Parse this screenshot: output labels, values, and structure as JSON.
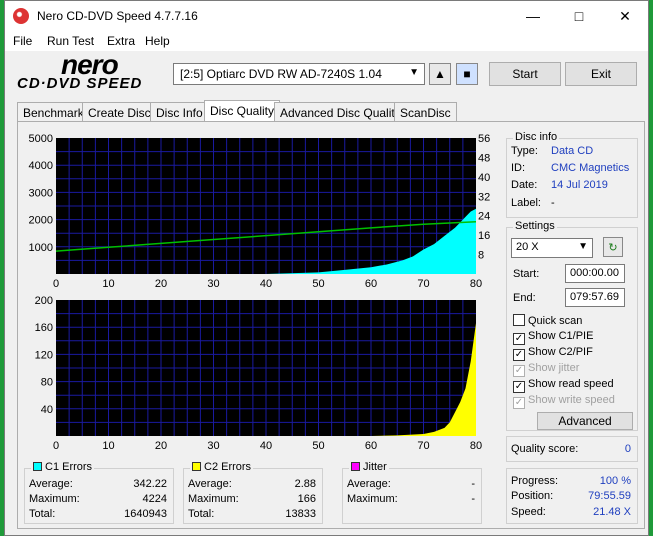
{
  "window": {
    "title": "Nero CD-DVD Speed 4.7.7.16"
  },
  "menu": [
    "File",
    "Run Test",
    "Extra",
    "Help"
  ],
  "logo": {
    "top": "nero",
    "bottom": "CD·DVD SPEED"
  },
  "toolbar": {
    "drive": "[2:5]   Optiarc DVD RW AD-7240S 1.04",
    "start_label": "Start",
    "exit_label": "Exit"
  },
  "tabs": [
    "Benchmark",
    "Create Disc",
    "Disc Info",
    "Disc Quality",
    "Advanced Disc Quality",
    "ScanDisc"
  ],
  "active_tab": "Disc Quality",
  "disc_info": {
    "title": "Disc info",
    "type_label": "Type:",
    "type": "Data CD",
    "id_label": "ID:",
    "id": "CMC Magnetics",
    "date_label": "Date:",
    "date": "14 Jul 2019",
    "label_label": "Label:",
    "label": "-"
  },
  "settings": {
    "title": "Settings",
    "speed": "20 X",
    "start_label": "Start:",
    "start": "000:00.00",
    "end_label": "End:",
    "end": "079:57.69",
    "quick_scan": "Quick scan",
    "show_c1": "Show C1/PIE",
    "show_c2": "Show C2/PIF",
    "show_jitter": "Show jitter",
    "show_read": "Show read speed",
    "show_write": "Show write speed",
    "advanced_label": "Advanced"
  },
  "quality": {
    "label": "Quality score:",
    "value": "0"
  },
  "progress": {
    "progress_label": "Progress:",
    "progress": "100 %",
    "position_label": "Position:",
    "position": "79:55.59",
    "speed_label": "Speed:",
    "speed": "21.48 X"
  },
  "c1": {
    "title": "C1 Errors",
    "avg_label": "Average:",
    "avg": "342.22",
    "max_label": "Maximum:",
    "max": "4224",
    "total_label": "Total:",
    "total": "1640943"
  },
  "c2": {
    "title": "C2 Errors",
    "avg_label": "Average:",
    "avg": "2.88",
    "max_label": "Maximum:",
    "max": "166",
    "total_label": "Total:",
    "total": "13833"
  },
  "jitter": {
    "title": "Jitter",
    "avg_label": "Average:",
    "avg": "-",
    "max_label": "Maximum:",
    "max": "-"
  },
  "colors": {
    "c1": "#00ffff",
    "c2": "#ffff00",
    "jitter": "#ff00ff",
    "speed": "#00c000",
    "grid": "#1a1aa0",
    "plot_bg": "#000000"
  },
  "chart_data": [
    {
      "type": "area",
      "x_ticks": [
        0,
        10,
        20,
        30,
        40,
        50,
        60,
        70,
        80
      ],
      "y_ticks": [
        1000,
        2000,
        3000,
        4000,
        5000
      ],
      "y2_ticks": [
        8,
        16,
        24,
        32,
        40,
        48,
        56
      ],
      "xlim": [
        0,
        80
      ],
      "ylim": [
        0,
        5000
      ],
      "y2lim": [
        0,
        56
      ],
      "series": [
        {
          "values_x": [
            0,
            40,
            50,
            55,
            60,
            63,
            66,
            68,
            70,
            72,
            74,
            76,
            77,
            78,
            79,
            80
          ],
          "values_y": [
            0,
            0,
            60,
            150,
            250,
            350,
            500,
            650,
            900,
            1100,
            1400,
            1700,
            1900,
            2100,
            2300,
            2400
          ]
        },
        {
          "values_x": [
            0,
            10,
            20,
            30,
            40,
            50,
            60,
            70,
            80
          ],
          "values_y": [
            9.4,
            11,
            12.6,
            14.2,
            15.8,
            17.4,
            19,
            20.5,
            21.5
          ]
        }
      ]
    },
    {
      "type": "area",
      "x_ticks": [
        0,
        10,
        20,
        30,
        40,
        50,
        60,
        70,
        80
      ],
      "y_ticks": [
        40,
        80,
        120,
        160,
        200
      ],
      "xlim": [
        0,
        80
      ],
      "ylim": [
        0,
        200
      ],
      "series": [
        {
          "values_x": [
            0,
            60,
            65,
            70,
            72,
            74,
            75,
            76,
            77,
            78,
            79,
            80
          ],
          "values_y": [
            0,
            0,
            1,
            3,
            6,
            12,
            20,
            35,
            50,
            70,
            110,
            166
          ]
        }
      ]
    }
  ]
}
